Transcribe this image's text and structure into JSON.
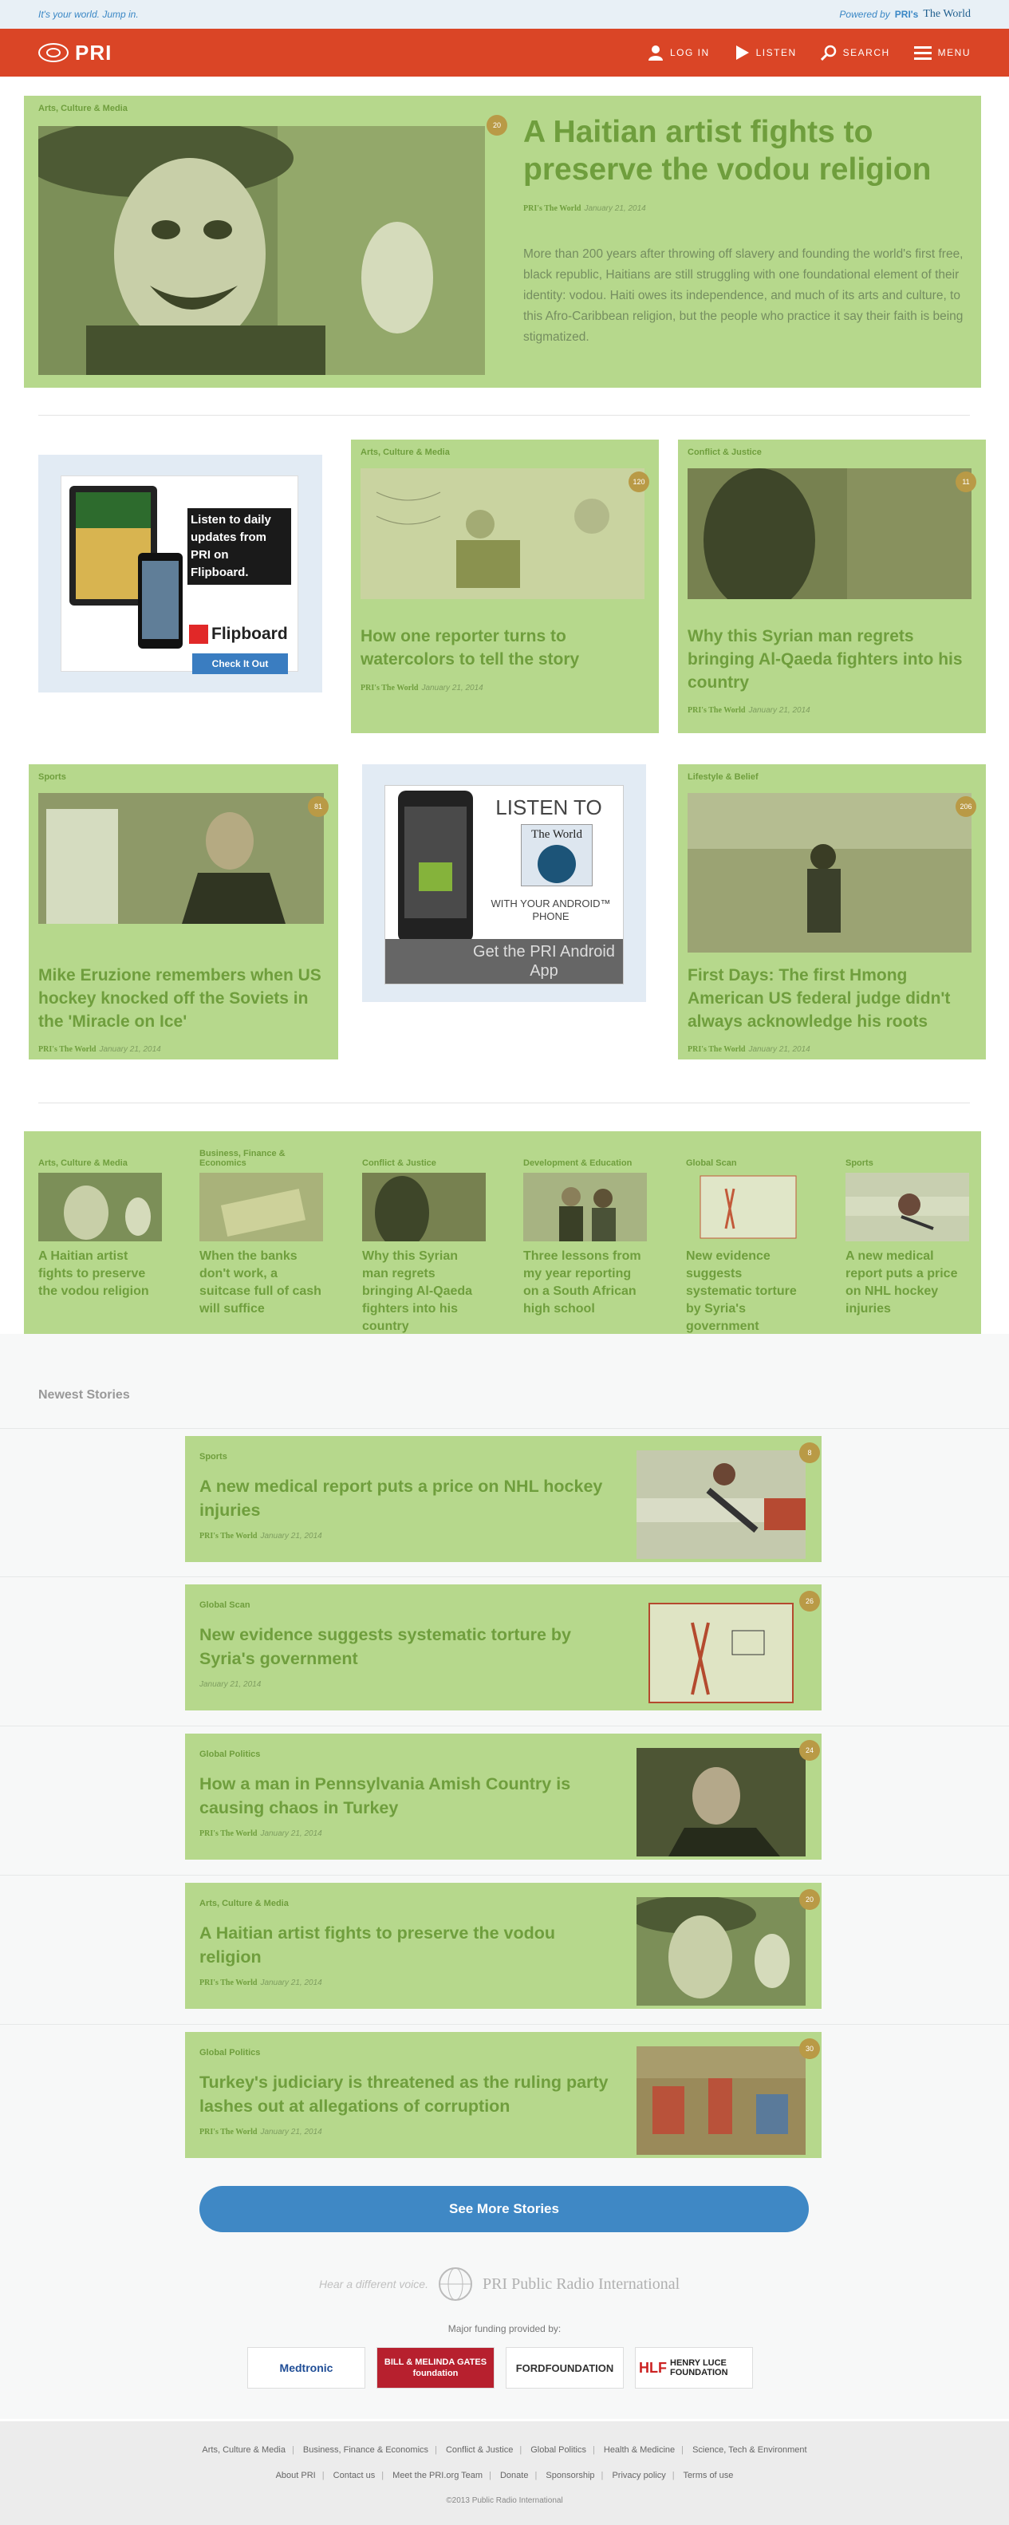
{
  "topbar": {
    "tagline": "It's your world. Jump in.",
    "powered_by": "Powered by",
    "powered_brand": "PRI's",
    "powered_show": "The World"
  },
  "nav": {
    "logo_text": "PRI",
    "login": "LOG IN",
    "listen": "LISTEN",
    "search": "SEARCH",
    "menu": "MENU"
  },
  "hero": {
    "category": "Arts, Culture & Media",
    "comments": "20",
    "title": "A Haitian artist fights to preserve the vodou religion",
    "source": "PRI's The World",
    "date": "January 21, 2014",
    "summary": "More than 200 years after throwing off slavery and founding the world's first free, black republic, Haitians are still struggling with one foundational element of their identity: vodou. Haiti owes its independence, and much of its arts and culture, to this Afro-Caribbean religion, but the people who practice it say their faith is being stigmatized."
  },
  "ads": {
    "flipboard_text": "Listen to daily updates from PRI on Flipboard.",
    "flipboard_brand": "Flipboard",
    "flipboard_cta": "Check It Out",
    "android_listen": "LISTEN TO",
    "android_show": "The World",
    "android_with": "WITH YOUR ANDROID™ PHONE",
    "android_get": "Get the PRI Android App",
    "android_pri": "PRI"
  },
  "grid_cards": [
    {
      "category": "Arts, Culture & Media",
      "comments": "120",
      "title": "How one reporter turns to watercolors to tell the story",
      "source": "PRI's The World",
      "date": "January 21, 2014"
    },
    {
      "category": "Conflict & Justice",
      "comments": "11",
      "title": "Why this Syrian man regrets bringing Al-Qaeda fighters into his country",
      "source": "PRI's The World",
      "date": "January 21, 2014"
    },
    {
      "category": "Sports",
      "comments": "81",
      "title": "Mike Eruzione remembers when US hockey knocked off the Soviets in the 'Miracle on Ice'",
      "source": "PRI's The World",
      "date": "January 21, 2014"
    },
    {
      "category": "Lifestyle & Belief",
      "comments": "206",
      "title": "First Days: The first Hmong American US federal judge didn't always acknowledge his roots",
      "source": "PRI's The World",
      "date": "January 21, 2014"
    }
  ],
  "section_strip": [
    {
      "category": "Arts, Culture & Media",
      "title": "A Haitian artist fights to preserve the vodou religion"
    },
    {
      "category": "Business, Finance & Economics",
      "title": "When the banks don't work, a suitcase full of cash will suffice"
    },
    {
      "category": "Conflict & Justice",
      "title": "Why this Syrian man regrets bringing Al-Qaeda fighters into his country"
    },
    {
      "category": "Development & Education",
      "title": "Three lessons from my year reporting on a South African high school"
    },
    {
      "category": "Global Scan",
      "title": "New evidence suggests systematic torture by Syria's government"
    },
    {
      "category": "Sports",
      "title": "A new medical report puts a price on NHL hockey injuries"
    }
  ],
  "newest": {
    "heading": "Newest Stories",
    "stories": [
      {
        "category": "Sports",
        "comments": "8",
        "title": "A new medical report puts a price on NHL hockey injuries",
        "source": "PRI's The World",
        "date": "January 21, 2014"
      },
      {
        "category": "Global Scan",
        "comments": "26",
        "title": "New evidence suggests systematic torture by Syria's government",
        "source": "",
        "date": "January 21, 2014"
      },
      {
        "category": "Global Politics",
        "comments": "24",
        "title": "How a man in Pennsylvania Amish Country is causing chaos in Turkey",
        "source": "PRI's The World",
        "date": "January 21, 2014"
      },
      {
        "category": "Arts, Culture & Media",
        "comments": "20",
        "title": "A Haitian artist fights to preserve the vodou religion",
        "source": "PRI's The World",
        "date": "January 21, 2014"
      },
      {
        "category": "Global Politics",
        "comments": "30",
        "title": "Turkey's judiciary is threatened as the ruling party lashes out at allegations of corruption",
        "source": "PRI's The World",
        "date": "January 21, 2014"
      }
    ],
    "more_button": "See More Stories"
  },
  "footer": {
    "slogan": "Hear a different voice.",
    "org": "PRI Public Radio International",
    "funding_label": "Major funding provided by:",
    "sponsors": [
      "Medtronic",
      "BILL & MELINDA GATES foundation",
      "FORDFOUNDATION",
      "HENRY LUCE FOUNDATION"
    ],
    "sponsor_luce_mark": "HLF",
    "categories": [
      "Arts, Culture & Media",
      "Business, Finance & Economics",
      "Conflict & Justice",
      "Global Politics",
      "Health & Medicine",
      "Science, Tech & Environment"
    ],
    "links": [
      "About PRI",
      "Contact us",
      "Meet the PRI.org Team",
      "Donate",
      "Sponsorship",
      "Privacy policy",
      "Terms of use"
    ],
    "copyright": "©2013 Public Radio International"
  }
}
